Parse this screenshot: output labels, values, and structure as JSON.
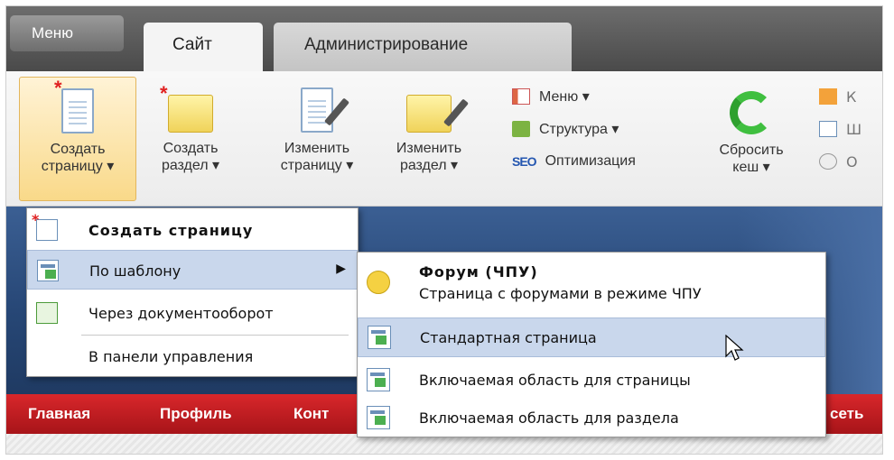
{
  "tabs": {
    "menu": "Меню",
    "site": "Сайт",
    "admin": "Администрирование"
  },
  "ribbon": {
    "create_page": [
      "Создать",
      "страницу ▾"
    ],
    "create_section": [
      "Создать",
      "раздел ▾"
    ],
    "edit_page": [
      "Изменить",
      "страницу ▾"
    ],
    "edit_section": [
      "Изменить",
      "раздел ▾"
    ],
    "menu": "Меню ▾",
    "structure": "Структура ▾",
    "seo_label": "SEO",
    "optimization": "Оптимизация",
    "reset_cache": [
      "Сбросить",
      "кеш ▾"
    ],
    "right_col": [
      "К",
      "Ш",
      "О"
    ]
  },
  "nav": {
    "items": [
      "Главная",
      "Профиль",
      "Конт",
      "сеть"
    ]
  },
  "menu1": {
    "items": [
      {
        "label": "Создать страницу",
        "bold": true
      },
      {
        "label": "По шаблону",
        "submenu": true
      },
      {
        "label": "Через документооборот"
      },
      {
        "label": "В панели управления"
      }
    ]
  },
  "menu2": {
    "forum_title": "Форум (ЧПУ)",
    "forum_desc": "Страница с форумами в режиме ЧПУ",
    "standard": "Стандартная страница",
    "include_page": "Включаемая область для страницы",
    "include_section": "Включаемая область для раздела"
  }
}
